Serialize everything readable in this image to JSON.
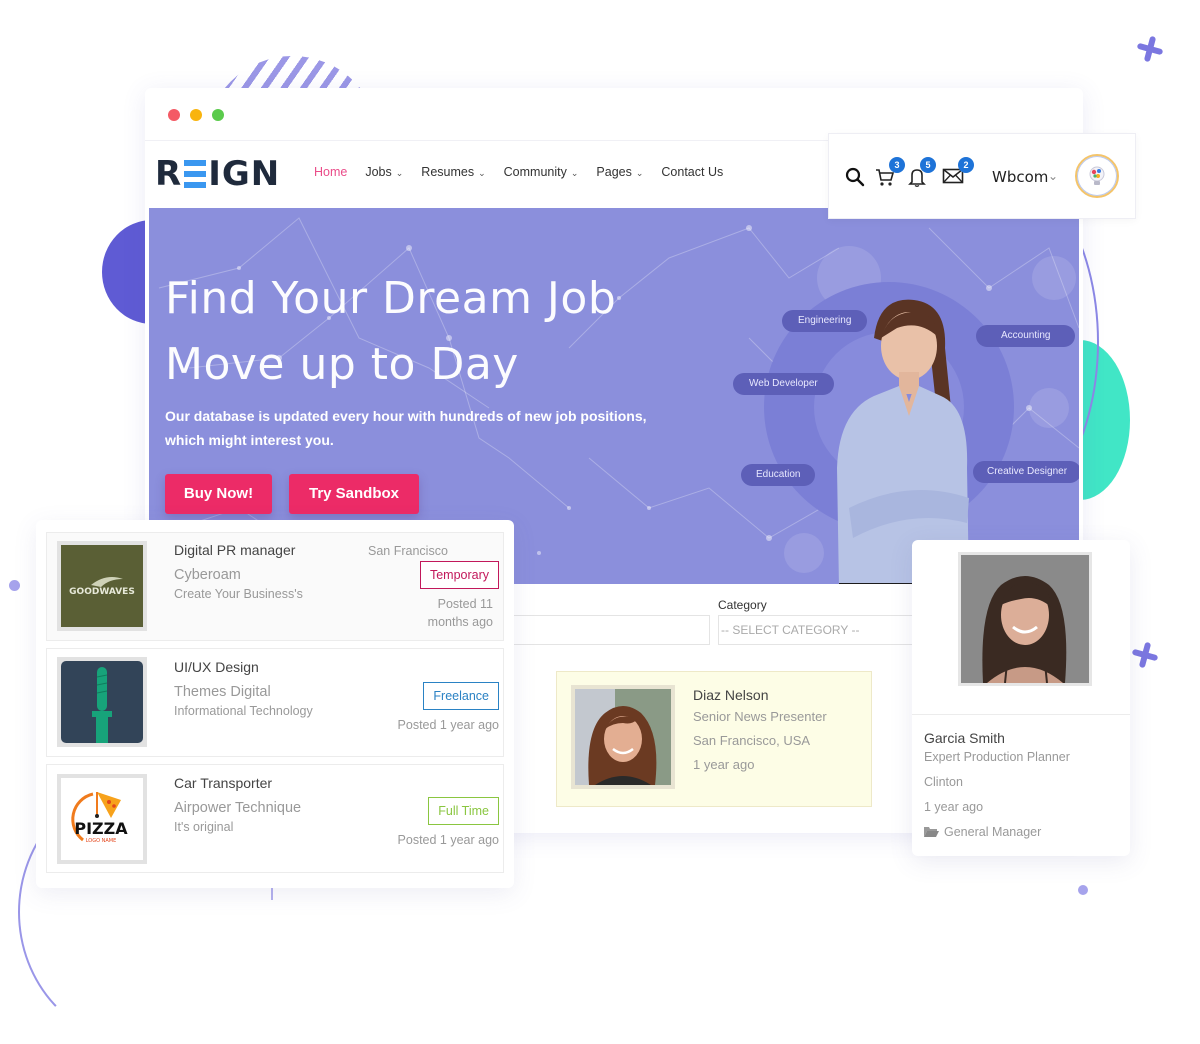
{
  "browser": {
    "window_controls": [
      "close",
      "minimize",
      "maximize"
    ]
  },
  "brand": {
    "logo_text": "REIGN",
    "logo_letters": [
      "R",
      "",
      "I",
      "G",
      "N"
    ]
  },
  "nav": {
    "items": [
      {
        "label": "Home",
        "active": true,
        "has_dropdown": false
      },
      {
        "label": "Jobs",
        "active": false,
        "has_dropdown": true
      },
      {
        "label": "Resumes",
        "active": false,
        "has_dropdown": true
      },
      {
        "label": "Community",
        "active": false,
        "has_dropdown": true
      },
      {
        "label": "Pages",
        "active": false,
        "has_dropdown": true
      },
      {
        "label": "Contact Us",
        "active": false,
        "has_dropdown": false
      }
    ],
    "chevron": "⌄"
  },
  "header_user": {
    "icons": [
      {
        "name": "search-icon",
        "badge": null
      },
      {
        "name": "cart-icon",
        "badge": "3"
      },
      {
        "name": "bell-icon",
        "badge": "5"
      },
      {
        "name": "mail-icon",
        "badge": "2"
      }
    ],
    "username": "Wbcom",
    "chevron": "⌵"
  },
  "hero": {
    "title_line1": "Find Your Dream Job",
    "title_line2": "Move up to Day",
    "subtitle": "Our database is updated every hour with hundreds of new job positions, which might interest you.",
    "buttons": {
      "primary": "Buy Now!",
      "secondary": "Try Sandbox"
    },
    "categories": [
      "Engineering",
      "Accounting",
      "Web Developer",
      "Education",
      "Creative Designer"
    ]
  },
  "search": {
    "category_label": "Category",
    "category_placeholder": "-- SELECT CATEGORY --"
  },
  "jobs": [
    {
      "title": "Digital PR manager",
      "company": "Cyberoam",
      "tagline": "Create Your Business's",
      "location": "San Francisco",
      "type": "Temporary",
      "type_color": "#c2185b",
      "posted": "Posted 11 months ago",
      "posted_lines": [
        "Posted 11",
        "months ago"
      ],
      "logo_text": "GOODWAVES"
    },
    {
      "title": "UI/UX Design",
      "company": "Themes Digital",
      "tagline": "Informational Technology",
      "location": "",
      "type": "Freelance",
      "type_color": "#2a82c4",
      "posted": "Posted 1 year ago",
      "posted_lines": [
        "Posted 1 year ago"
      ],
      "logo_text": ""
    },
    {
      "title": "Car Transporter",
      "company": "Airpower Technique",
      "tagline": "It's original",
      "location": "",
      "type": "Full Time",
      "type_color": "#8ac640",
      "posted": "Posted 1 year ago",
      "posted_lines": [
        "Posted 1 year ago"
      ],
      "logo_text": "PIZZA",
      "logo_subtext": "LOGO NAME"
    }
  ],
  "resume": {
    "name": "Diaz Nelson",
    "title": "Senior News Presenter",
    "location": "San Francisco, USA",
    "time": "1 year ago"
  },
  "candidate": {
    "name": "Garcia Smith",
    "title": "Expert Production Planner",
    "location": "Clinton",
    "time": "1 year ago",
    "category": "General Manager"
  },
  "colors": {
    "accent_pink": "#ec2b67",
    "nav_active": "#ea4c89",
    "hero_bg": "#8b8fdc",
    "badge_blue": "#1e73d8",
    "teal_deco": "#41e6c6",
    "purple_deco": "#5f5bd4"
  }
}
